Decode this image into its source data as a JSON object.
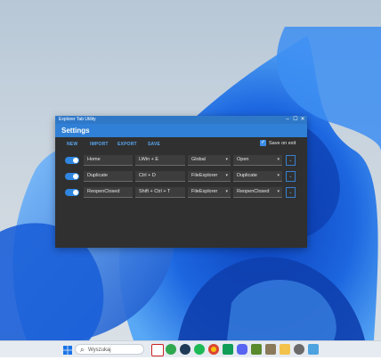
{
  "window": {
    "title": "Explorer Tab Utility",
    "header": "Settings",
    "controls": {
      "minimize": "–",
      "maximize": "☐",
      "close": "✕"
    }
  },
  "toolbar": {
    "new": "NEW",
    "import": "IMPORT",
    "export": "EXPORT",
    "save": "SAVE",
    "save_on_exit": {
      "label": "Save on exit",
      "checked": true
    }
  },
  "rows": [
    {
      "enabled": true,
      "name": "Home",
      "hotkey": "LWin + E",
      "scope": "Global",
      "action": "Open"
    },
    {
      "enabled": true,
      "name": "Duplicate",
      "hotkey": "Ctrl + D",
      "scope": "FileExplorer",
      "action": "Duplicate"
    },
    {
      "enabled": true,
      "name": "ReopenClosed",
      "hotkey": "Shift + Ctrl + T",
      "scope": "FileExplorer",
      "action": "ReopenClosed"
    }
  ],
  "taskbar": {
    "search_placeholder": "Wyszukaj",
    "icons": [
      "start-icon",
      "search-icon",
      "steam-icon",
      "xbox-icon",
      "spotify-icon",
      "edge-icon",
      "chrome-icon",
      "game-icon",
      "discord-icon",
      "minecraft-icon",
      "explorer-icon",
      "settings-icon",
      "photos-icon"
    ]
  },
  "colors": {
    "accent": "#2f80d6",
    "window_bg": "#303030",
    "field_bg": "#3d3d3d"
  }
}
